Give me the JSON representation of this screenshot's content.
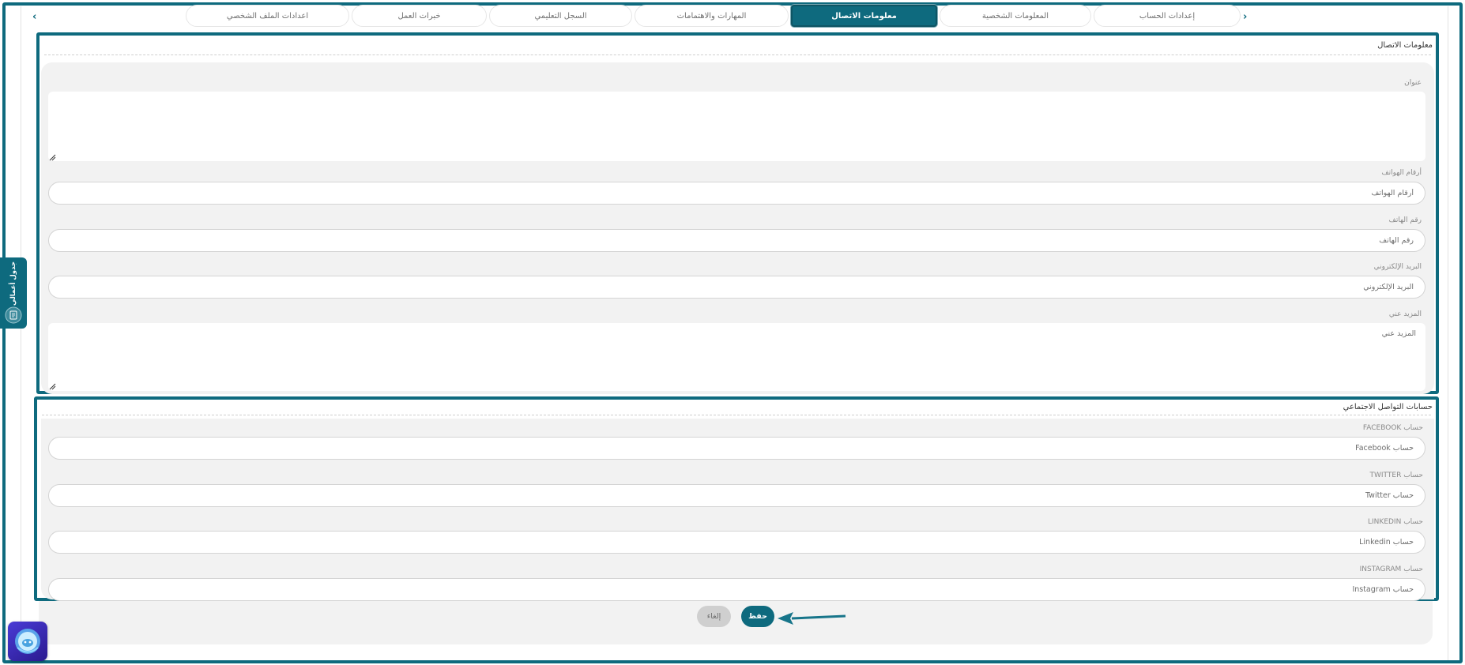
{
  "tabs": {
    "items": [
      {
        "label": "إعدادات الحساب"
      },
      {
        "label": "المعلومات الشخصية"
      },
      {
        "label": "معلومات الاتصال"
      },
      {
        "label": "المهارات والاهتمامات"
      },
      {
        "label": "السجل التعليمي"
      },
      {
        "label": "خبرات العمل"
      },
      {
        "label": "اعدادات الملف الشخصي"
      }
    ],
    "active": "معلومات الاتصال"
  },
  "contact_section": {
    "title": "معلومات الاتصال",
    "address": {
      "label": "عنوان",
      "value": "",
      "placeholder": ""
    },
    "phones": {
      "label": "أرقام الهواتف",
      "value": "",
      "placeholder": "أرقام الهواتف"
    },
    "phone": {
      "label": "رقم الهاتف",
      "value": "",
      "placeholder": "رقم الهاتف"
    },
    "email": {
      "label": "البريد الإلكتروني",
      "value": "",
      "placeholder": "البريد الإلكتروني"
    },
    "about": {
      "label": "المزيد عني",
      "value": "",
      "placeholder": "المزيد عني"
    }
  },
  "social_section": {
    "title": "حسابات التواصل الاجتماعي",
    "facebook": {
      "label": "حساب FACEBOOK",
      "value": "",
      "placeholder": "حساب Facebook"
    },
    "twitter": {
      "label": "حساب TWITTER",
      "value": "",
      "placeholder": "حساب Twitter"
    },
    "linkedin": {
      "label": "حساب LINKEDIN",
      "value": "",
      "placeholder": "حساب Linkedin"
    },
    "instagram": {
      "label": "حساب INSTAGRAM",
      "value": "",
      "placeholder": "حساب Instagram"
    }
  },
  "actions": {
    "save_label": "حفظ",
    "cancel_label": "إلغاء"
  },
  "side_tab": {
    "label": "جدول أعمالي",
    "icon": "notebook-icon"
  },
  "assistant": {
    "icon": "assistant-orb-icon"
  },
  "colors": {
    "accent": "#0e6a7e",
    "panel": "#f2f2f2",
    "cancel": "#cfcfcf"
  }
}
